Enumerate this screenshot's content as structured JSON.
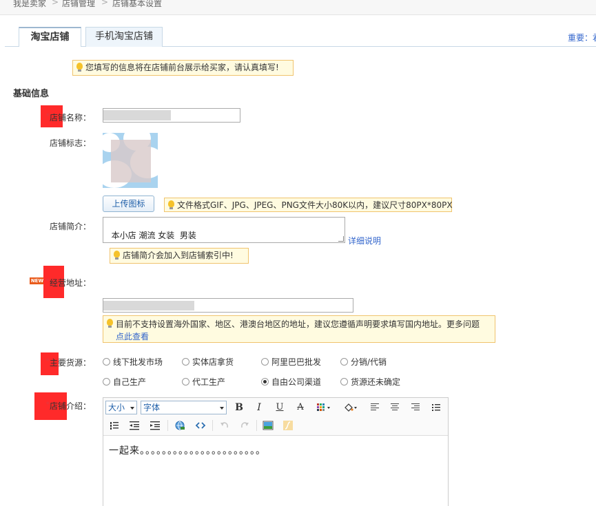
{
  "breadcrumb": {
    "items": [
      "我是卖家",
      "店铺管理",
      "店铺基本设置"
    ],
    "separator": ">"
  },
  "tabs": [
    {
      "label": "淘宝店铺",
      "active": true
    },
    {
      "label": "手机淘宝店铺",
      "active": false
    }
  ],
  "tab_right_text": "重要：君",
  "notice": "您填写的信息将在店铺前台展示给买家，请认真填写!",
  "section_title": "基础信息",
  "required_mark": "*",
  "fields": {
    "shop_name": {
      "label": "店铺名称："
    },
    "shop_logo": {
      "label": "店铺标志：",
      "upload_button": "上传图标",
      "tip": "文件格式GIF、JPG、JPEG、PNG文件大小80K以内，建议尺寸80PX*80PX"
    },
    "shop_intro": {
      "label": "店铺简介：",
      "value": "本小店 潮流 女装  男装",
      "detail_link": "详细说明",
      "tip": "店铺简介会加入到店铺索引中!"
    },
    "address": {
      "label": "经营地址：",
      "badge": "NEW",
      "tip": "目前不支持设置海外国家、地区、港澳台地区的地址，建议您遵循声明要求填写国内地址。更多问题",
      "tip_link": "点此查看"
    },
    "source": {
      "label": "主要货源：",
      "options": [
        "线下批发市场",
        "实体店拿货",
        "阿里巴巴批发",
        "分销/代销",
        "自己生产",
        "代工生产",
        "自由公司渠道",
        "货源还未确定"
      ],
      "selected": "自由公司渠道"
    },
    "description": {
      "label": "店铺介绍：",
      "toolbar": {
        "size_select": "大小",
        "font_select": "字体",
        "bold": "B",
        "italic": "I",
        "underline": "U",
        "strike": "A"
      },
      "content": "一起来。。。。。。。。。。。。。。。。。。。。。。"
    }
  }
}
